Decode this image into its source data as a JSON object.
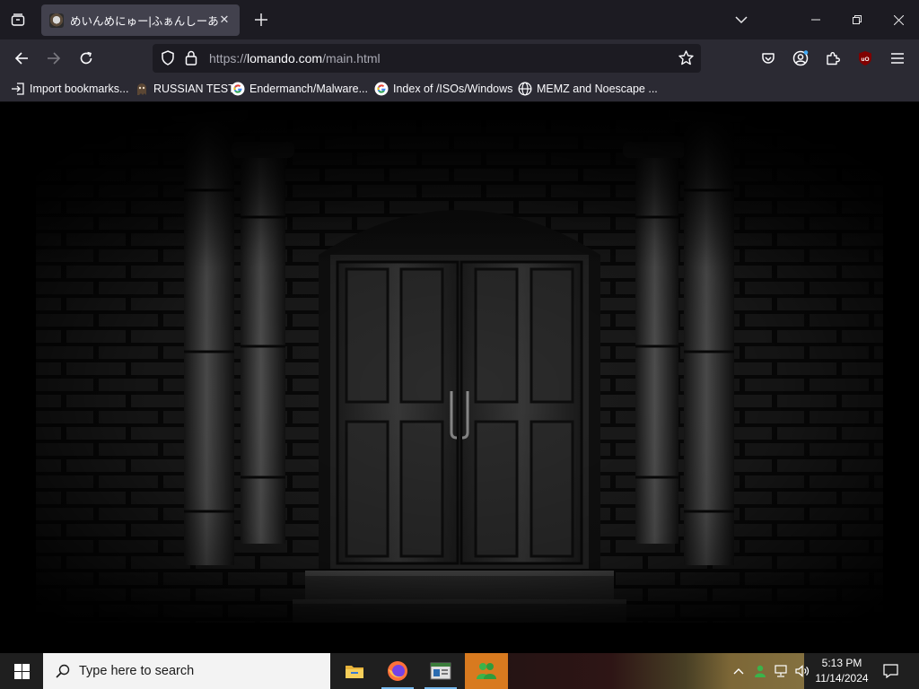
{
  "browser": {
    "tab": {
      "title": "めいんめにゅー|ふぁんしーあい"
    },
    "url": {
      "scheme": "https://",
      "host": "lomando.com",
      "path": "/main.html"
    },
    "bookmarks": [
      {
        "label": "Import bookmarks...",
        "icon": "import-icon"
      },
      {
        "label": "RUSSIAN TEST",
        "icon": "ghost-icon"
      },
      {
        "label": "Endermanch/Malware...",
        "icon": "google-icon"
      },
      {
        "label": "Index of /ISOs/Windows",
        "icon": "google-icon"
      },
      {
        "label": "MEMZ and Noescape ...",
        "icon": "globe-icon"
      }
    ]
  },
  "taskbar": {
    "search_placeholder": "Type here to search",
    "time": "5:13 PM",
    "date": "11/14/2024",
    "apps": [
      "file-explorer-icon",
      "firefox-icon",
      "terminal-app-icon",
      "game-app-icon"
    ]
  },
  "colors": {
    "tabbar_bg": "#1c1b22",
    "toolbar_bg": "#2b2a33",
    "active_tab_bg": "#42414d",
    "urlbar_bg": "#1c1b22",
    "taskbar_bg": "#1f1f1f",
    "taskbar_active": "#d87a1f",
    "accent": "#76b9ed"
  }
}
